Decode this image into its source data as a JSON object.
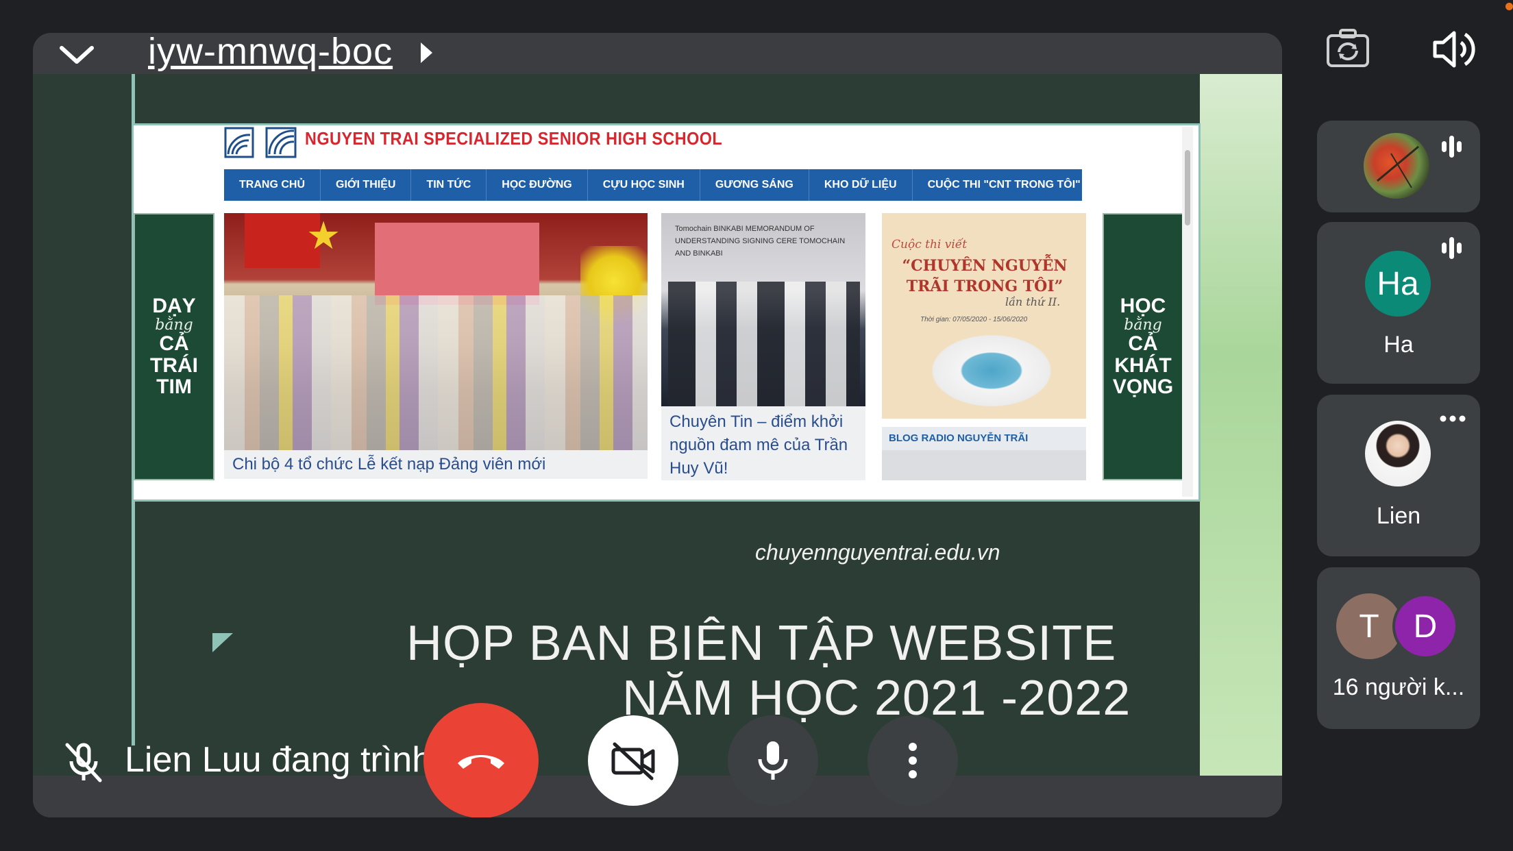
{
  "meeting": {
    "code": "iyw-mnwq-boc"
  },
  "presenter": {
    "text": "Lien Luu đang trình bày"
  },
  "shared_slide": {
    "school_name": "NGUYEN TRAI SPECIALIZED SENIOR HIGH SCHOOL",
    "nav": [
      "TRANG CHỦ",
      "GIỚI THIỆU",
      "TIN TỨC",
      "HỌC ĐƯỜNG",
      "CỰU HỌC SINH",
      "GƯƠNG SÁNG",
      "KHO DỮ LIỆU",
      "CUỘC THI \"CNT TRONG TÔI\""
    ],
    "left_banner": {
      "l1": "DẠY",
      "l2": "bằng",
      "l3": "CẢ",
      "l4": "TRÁI",
      "l5": "TIM"
    },
    "right_banner": {
      "l1": "HỌC",
      "l2": "bằng",
      "l3": "CẢ",
      "l4": "KHÁT",
      "l5": "VỌNG"
    },
    "article1_caption": "Chi bộ 4 tổ chức Lễ kết nạp Đảng viên mới",
    "article2_caption": "Chuyên Tin – điểm khởi nguồn đam mê của Trần Huy Vũ!",
    "article2_banner": "Tomochain  BINKABI MEMORANDUM OF UNDERSTANDING SIGNING CERE TOMOCHAIN AND BINKABI",
    "poster": {
      "line1": "Cuộc thi viết",
      "line2": "“CHUYÊN NGUYỄN TRÃI TRONG TÔI”",
      "line3": "lần thứ II.",
      "line4": "Thời gian: 07/05/2020 - 15/06/2020"
    },
    "blog_label": "BLOG RADIO NGUYỄN TRÃI",
    "site_url": "chuyennguyentrai.edu.vn",
    "title_line1": "HỌP BAN BIÊN TẬP WEBSITE",
    "title_line2": "NĂM HỌC 2021 -2022"
  },
  "participants": [
    {
      "name": "",
      "avatar": "leaf-photo",
      "status": "speaking"
    },
    {
      "name": "Ha",
      "initials": "Ha",
      "color": "#0b8a78",
      "status": "speaking"
    },
    {
      "name": "Lien",
      "avatar": "portrait-photo",
      "status": "more"
    },
    {
      "name": "16 người k...",
      "initials": [
        "T",
        "D"
      ],
      "colors": [
        "#8d6e63",
        "#8e24aa"
      ]
    }
  ],
  "colors": {
    "end_call": "#ea4335",
    "background": "#1f2023",
    "tile": "#3c4043"
  },
  "icons": [
    "chevron-down-icon",
    "flip-camera-icon",
    "speaker-icon",
    "mic-off-icon",
    "end-call-icon",
    "camera-off-icon",
    "mic-icon",
    "more-vert-icon"
  ]
}
